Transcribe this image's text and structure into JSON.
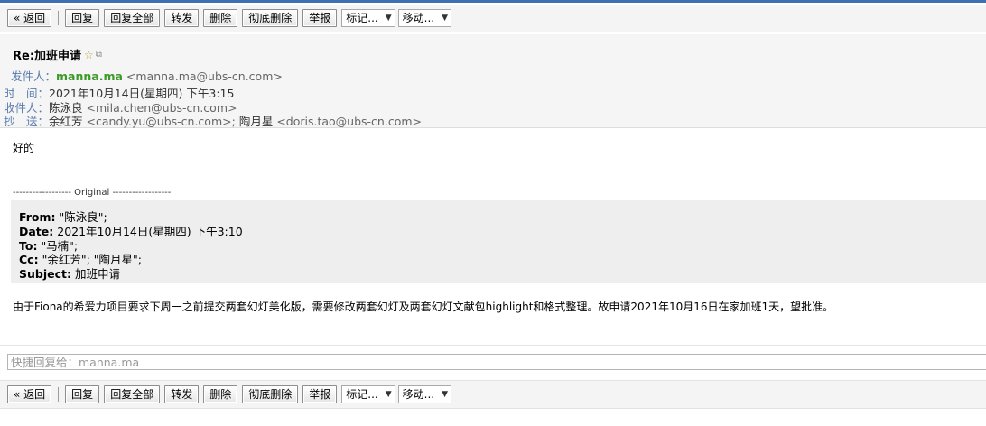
{
  "toolbar": {
    "buttons": [
      "« 返回",
      "回复",
      "回复全部",
      "转发",
      "删除",
      "彻底删除",
      "举报"
    ],
    "mark_select": "标记...",
    "move_select": "移动..."
  },
  "header": {
    "subject": "Re:加班申请",
    "from_label": "发件人：",
    "from_name": "manna.ma",
    "from_email": "<manna.ma@ubs-cn.com>",
    "time_label": "时　间：",
    "time_value": "2021年10月14日(星期四) 下午3:15",
    "to_label": "收件人：",
    "to_name": "陈泳良",
    "to_email": "<mila.chen@ubs-cn.com>",
    "cc_label": "抄　送：",
    "cc_name1": "余红芳",
    "cc_email1": "<candy.yu@ubs-cn.com>;",
    "cc_name2": "陶月星",
    "cc_email2": "<doris.tao@ubs-cn.com>"
  },
  "body": {
    "reply": "好的",
    "original_divider": "------------------ Original ------------------",
    "quote": {
      "from_label": "From:",
      "from_value": "\"陈泳良\";",
      "date_label": "Date:",
      "date_value": "2021年10月14日(星期四) 下午3:10",
      "to_label": "To:",
      "to_value": "\"马楠\";",
      "cc_label": "Cc:",
      "cc_value": "\"余红芳\"; \"陶月星\";",
      "subject_label": "Subject:",
      "subject_value": "加班申请"
    },
    "message": "由于Fiona的希爱力项目要求下周一之前提交两套幻灯美化版，需要修改两套幻灯及两套幻灯文献包highlight和格式整理。故申请2021年10月16日在家加班1天，望批准。"
  },
  "quick_reply": {
    "placeholder": "快捷回复给：manna.ma"
  }
}
